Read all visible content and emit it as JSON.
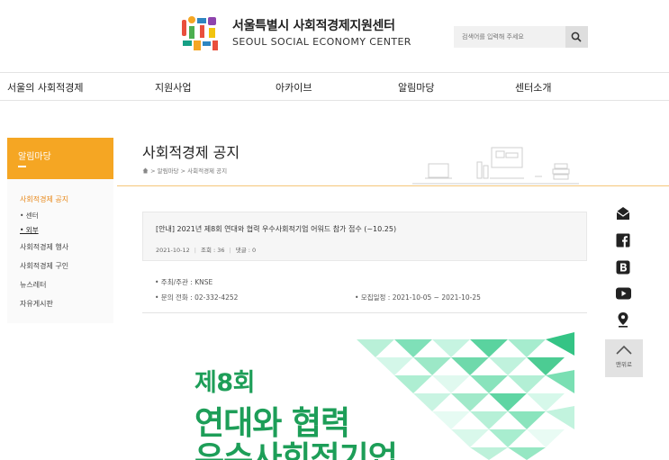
{
  "header": {
    "logo_title_ko": "서울특별시 사회적경제지원센터",
    "logo_title_en": "SEOUL SOCIAL ECONOMY CENTER",
    "search_placeholder": "검색어를 입력해 주세요"
  },
  "nav": {
    "items": [
      "서울의 사회적경제",
      "지원사업",
      "아카이브",
      "알림마당",
      "센터소개"
    ]
  },
  "sidebar": {
    "title": "알림마당",
    "items": [
      {
        "label": "사회적경제 공지"
      },
      {
        "label": "• 센터"
      },
      {
        "label": "• 외부"
      },
      {
        "label": "사회적경제 행사"
      },
      {
        "label": "사회적경제 구인"
      },
      {
        "label": "뉴스레터"
      },
      {
        "label": "자유게시판"
      }
    ]
  },
  "page": {
    "title": "사회적경제 공지",
    "breadcrumb": [
      "알림마당",
      "사회적경제 공지"
    ]
  },
  "post": {
    "title": "[안내] 2021년 제8회 연대와 협력 우수사회적기업 어워드 참가 접수 (~10.25)",
    "date": "2021-10-12",
    "views": "조회 : 36",
    "comments": "댓글 : 0",
    "host": "• 주최/주관 : KNSE",
    "phone": "• 문의 전화 : 02-332-4252",
    "period": "• 모집일정 : 2021-10-05 ~ 2021-10-25"
  },
  "poster": {
    "number": "제8회",
    "line1": "연대와 협력",
    "line2": "우수사회적기업"
  },
  "quick_links": [
    "mail-icon",
    "facebook-icon",
    "blog-icon",
    "youtube-icon",
    "location-icon"
  ],
  "top_button": "맨위로",
  "colors": {
    "accent": "#f5a623",
    "accent_text": "#e8891c",
    "poster_green": "#1d9e58",
    "poster_mint": "#7fe0b8"
  }
}
